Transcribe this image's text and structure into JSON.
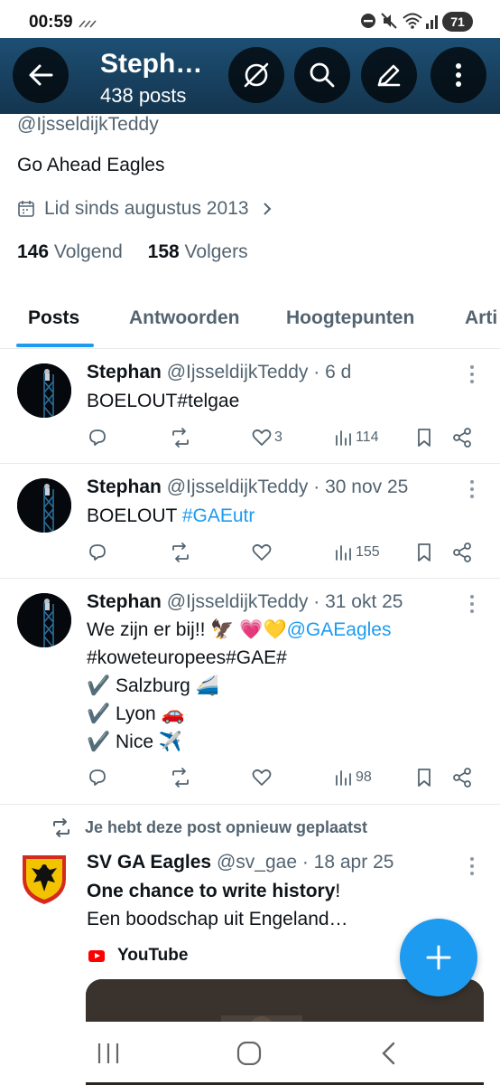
{
  "status_bar": {
    "time": "00:59",
    "battery": "71"
  },
  "header": {
    "name": "Steph…",
    "posts_count": "438 posts"
  },
  "profile": {
    "handle": "@IjsseldijkTeddy",
    "bio": "Go Ahead Eagles",
    "joined": "Lid sinds augustus 2013",
    "following_count": "146",
    "following_label": "Volgend",
    "followers_count": "158",
    "followers_label": "Volgers"
  },
  "tabs": [
    {
      "label": "Posts",
      "active": true
    },
    {
      "label": "Antwoorden"
    },
    {
      "label": "Hoogtepunten"
    },
    {
      "label": "Arti"
    }
  ],
  "posts": [
    {
      "name": "Stephan",
      "handle": "@IjsseldijkTeddy",
      "date": "· 6 d",
      "text": "BOELOUT#telgae",
      "likes": "3",
      "views": "114"
    },
    {
      "name": "Stephan",
      "handle": "@IjsseldijkTeddy",
      "date": "· 30 nov 25",
      "text": "BOELOUT",
      "hashtag": "#GAEutr",
      "likes": "",
      "views": "155"
    },
    {
      "name": "Stephan",
      "handle": "@IjsseldijkTeddy",
      "date": "· 31 okt 25",
      "line1": "We zijn er bij!! 🦅 💗💛",
      "mention": "@GAEagles",
      "line2": "#koweteuropees#GAE#",
      "line3": "✔️ Salzburg 🚄",
      "line4": "✔️ Lyon 🚗",
      "line5": "✔️ Nice ✈️",
      "likes": "",
      "views": "98"
    }
  ],
  "repost": {
    "note": "Je hebt deze post opnieuw geplaatst",
    "name": "SV GA Eagles",
    "handle": "@sv_gae",
    "date": "· 18 apr 25",
    "title_bold": "One chance to write history",
    "title_rest": "!",
    "subtitle": "Een boodschap uit Engeland…",
    "source": "YouTube"
  },
  "colors": {
    "accent": "#1d9bf0",
    "header_bg": "#1d4f73",
    "text_secondary": "#536471"
  }
}
